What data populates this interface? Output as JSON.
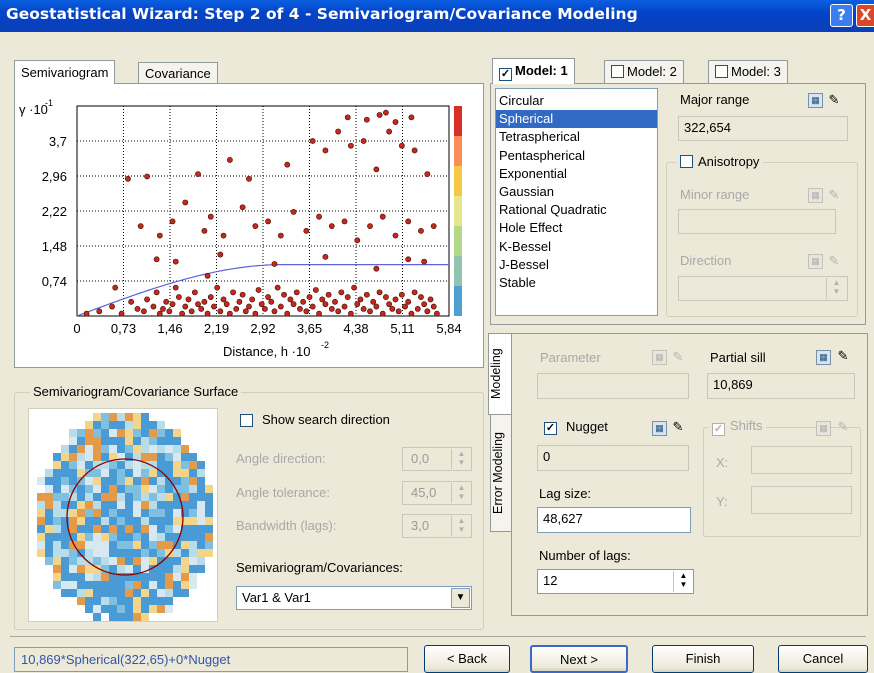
{
  "window": {
    "title": "Geostatistical Wizard: Step 2 of 4 - Semivariogram/Covariance Modeling",
    "help_glyph": "?",
    "close_glyph": "X"
  },
  "left_tabs": [
    {
      "label": "Semivariogram"
    },
    {
      "label": "Covariance"
    }
  ],
  "chart_data": {
    "type": "scatter",
    "ylabel_base": "γ ·10",
    "ylabel_exp": "-1",
    "xlabel_base": "Distance, h ·10",
    "xlabel_exp": "-2",
    "xlim": [
      0,
      5.84
    ],
    "ylim": [
      0,
      4.44
    ],
    "x_ticks": [
      "0",
      "0,73",
      "1,46",
      "2,19",
      "2,92",
      "3,65",
      "4,38",
      "5,11",
      "5,84"
    ],
    "y_ticks": [
      "0,74",
      "1,48",
      "2,22",
      "2,96",
      "3,7"
    ],
    "grid": true,
    "colorbar": [
      "#d73027",
      "#fc8d59",
      "#f7c844",
      "#e6e68a",
      "#b3d88a",
      "#91c4b0",
      "#4f9fd0"
    ],
    "points": {
      "color": "#c8281c",
      "x": [
        0.15,
        0.35,
        0.55,
        0.6,
        0.7,
        0.85,
        0.95,
        1.05,
        1.1,
        1.2,
        1.25,
        1.3,
        1.35,
        1.4,
        1.45,
        1.5,
        1.55,
        1.6,
        1.65,
        1.7,
        1.75,
        1.8,
        1.85,
        1.9,
        1.95,
        2.0,
        2.05,
        2.1,
        2.15,
        2.2,
        2.25,
        2.3,
        2.35,
        2.4,
        2.45,
        2.5,
        2.55,
        2.6,
        2.65,
        2.7,
        2.75,
        2.8,
        2.85,
        2.9,
        2.95,
        3.0,
        3.05,
        3.1,
        3.15,
        3.2,
        3.25,
        3.3,
        3.35,
        3.4,
        3.45,
        3.5,
        3.55,
        3.6,
        3.65,
        3.7,
        3.75,
        3.8,
        3.85,
        3.9,
        3.95,
        4.0,
        4.05,
        4.1,
        4.15,
        4.2,
        4.25,
        4.3,
        4.35,
        4.4,
        4.45,
        4.5,
        4.55,
        4.6,
        4.65,
        4.7,
        4.75,
        4.8,
        4.85,
        4.9,
        4.95,
        5.0,
        5.05,
        5.1,
        5.15,
        5.2,
        5.25,
        5.3,
        5.35,
        5.4,
        5.45,
        5.5,
        5.55,
        5.6,
        5.65,
        1.0,
        1.3,
        1.5,
        1.7,
        2.0,
        2.1,
        2.3,
        2.6,
        2.8,
        3.0,
        3.2,
        3.4,
        3.6,
        3.8,
        4.0,
        4.2,
        4.4,
        4.6,
        4.8,
        5.0,
        5.2,
        5.4,
        5.6,
        0.8,
        1.1,
        1.9,
        2.4,
        2.7,
        3.3,
        3.7,
        3.9,
        4.1,
        4.3,
        4.5,
        4.7,
        4.9,
        5.1,
        5.3,
        5.5,
        4.25,
        4.55,
        4.75,
        4.85,
        5.25,
        5.0,
        5.2,
        1.25,
        1.55,
        2.05,
        2.25,
        3.1,
        3.9,
        4.7,
        5.45
      ],
      "y": [
        0.05,
        0.1,
        0.2,
        0.6,
        0.05,
        0.3,
        0.15,
        0.1,
        0.35,
        0.2,
        0.5,
        0.05,
        0.15,
        0.3,
        0.1,
        0.25,
        0.6,
        0.4,
        0.05,
        0.2,
        0.35,
        0.1,
        0.5,
        0.25,
        0.15,
        0.3,
        0.05,
        0.4,
        0.2,
        0.6,
        0.1,
        0.35,
        0.25,
        0.05,
        0.5,
        0.15,
        0.3,
        0.45,
        0.1,
        0.2,
        0.35,
        0.05,
        0.55,
        0.25,
        0.15,
        0.4,
        0.3,
        0.1,
        0.6,
        0.2,
        0.45,
        0.05,
        0.35,
        0.25,
        0.5,
        0.15,
        0.3,
        0.1,
        0.4,
        0.2,
        0.55,
        0.05,
        0.35,
        0.25,
        0.45,
        0.15,
        0.3,
        0.1,
        0.5,
        0.2,
        0.4,
        0.05,
        0.6,
        0.25,
        0.35,
        0.15,
        0.45,
        0.1,
        0.3,
        0.2,
        0.5,
        0.05,
        0.4,
        0.25,
        0.15,
        0.35,
        0.1,
        0.45,
        0.2,
        0.3,
        0.05,
        0.5,
        0.15,
        0.4,
        0.25,
        0.1,
        0.35,
        0.2,
        0.05,
        1.9,
        1.7,
        2.0,
        2.4,
        1.8,
        2.1,
        1.7,
        2.3,
        1.9,
        2.0,
        1.7,
        2.2,
        1.8,
        2.1,
        1.9,
        2.0,
        1.6,
        1.9,
        2.1,
        1.7,
        2.0,
        1.8,
        1.9,
        2.9,
        2.95,
        3.0,
        3.3,
        2.9,
        3.2,
        3.7,
        3.5,
        3.9,
        3.6,
        3.7,
        3.1,
        3.9,
        3.6,
        3.5,
        3.0,
        4.2,
        4.15,
        4.25,
        4.3,
        4.2,
        4.1,
        1.2,
        1.2,
        1.15,
        0.85,
        1.3,
        1.1,
        1.25,
        1.0,
        1.15,
        3.95,
        3.5,
        3.2,
        3.4,
        3.8,
        4.3,
        4.2
      ]
    },
    "model_curve": {
      "color": "#6060e0",
      "range": 3.22654,
      "sill": 1.0869
    }
  },
  "surface": {
    "group_label": "Semivariogram/Covariance Surface",
    "show_search_direction": {
      "label": "Show search direction",
      "checked": false
    },
    "angle_direction": {
      "label": "Angle direction:",
      "value": "0,0"
    },
    "angle_tolerance": {
      "label": "Angle tolerance:",
      "value": "45,0"
    },
    "bandwidth": {
      "label": "Bandwidth (lags):",
      "value": "3,0"
    },
    "semivar_label": "Semivariogram/Covariances:",
    "semivar_value": "Var1 & Var1"
  },
  "model_tabs": [
    {
      "label": "Model: 1",
      "checked": true
    },
    {
      "label": "Model: 2",
      "checked": false
    },
    {
      "label": "Model: 3",
      "checked": false
    }
  ],
  "model_list": {
    "items": [
      "Circular",
      "Spherical",
      "Tetraspherical",
      "Pentaspherical",
      "Exponential",
      "Gaussian",
      "Rational Quadratic",
      "Hole Effect",
      "K-Bessel",
      "J-Bessel",
      "Stable"
    ],
    "selected": "Spherical"
  },
  "major_range": {
    "label": "Major range",
    "value": "322,654"
  },
  "anisotropy": {
    "label": "Anisotropy",
    "checked": false
  },
  "minor_range": {
    "label": "Minor range",
    "value": ""
  },
  "direction": {
    "label": "Direction",
    "value": ""
  },
  "side_tabs": {
    "modeling": "Modeling",
    "error_modeling": "Error Modeling"
  },
  "parameter": {
    "label": "Parameter",
    "value": ""
  },
  "partial_sill": {
    "label": "Partial sill",
    "value": "10,869"
  },
  "nugget": {
    "label": "Nugget",
    "checked": true,
    "value": "0"
  },
  "shifts": {
    "label": "Shifts",
    "checked": true,
    "x_label": "X:",
    "y_label": "Y:"
  },
  "lag_size": {
    "label": "Lag size:",
    "value": "48,627"
  },
  "number_of_lags": {
    "label": "Number of lags:",
    "value": "12"
  },
  "footer": {
    "formula": "10,869*Spherical(322,65)+0*Nugget",
    "back": "< Back",
    "next": "Next >",
    "finish": "Finish",
    "cancel": "Cancel"
  }
}
